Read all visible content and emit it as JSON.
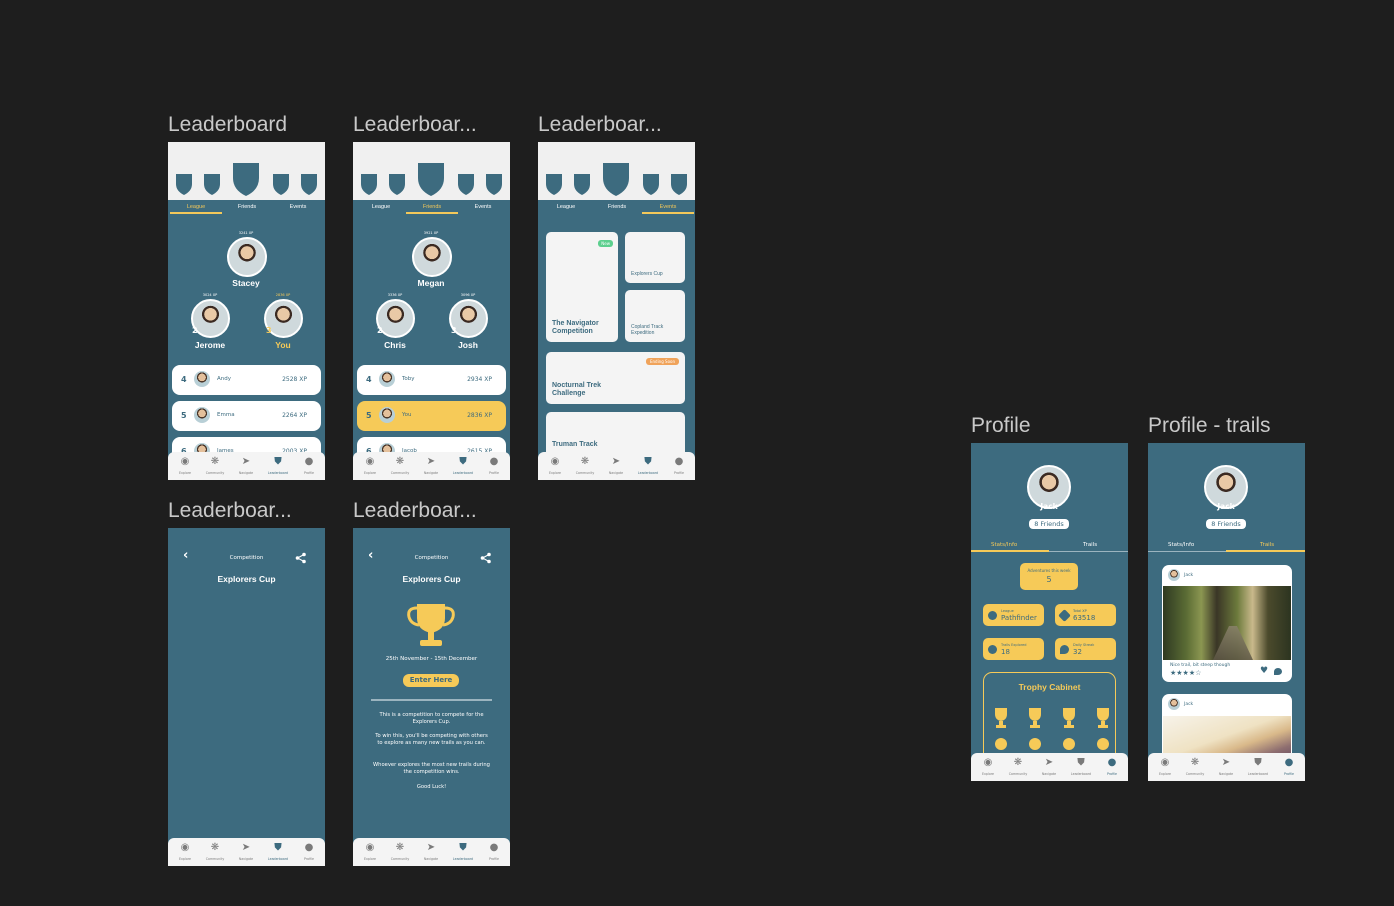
{
  "frames": {
    "lb1": "Leaderboard",
    "lb2": "Leaderboar...",
    "lb3": "Leaderboar...",
    "lb4": "Leaderboar...",
    "lb5": "Leaderboar...",
    "profile": "Profile",
    "profile_trails": "Profile - trails"
  },
  "tabs": {
    "league": "League",
    "friends": "Friends",
    "events": "Events"
  },
  "nav": {
    "explore": "Explore",
    "community": "Community",
    "navigate": "Navigate",
    "leaderboard": "Leaderboard",
    "profile": "Profile"
  },
  "league": {
    "first": {
      "name": "Stacey",
      "xp": "3241 XP"
    },
    "second": {
      "name": "Jerome",
      "xp": "3024 XP",
      "rank": "2"
    },
    "third": {
      "name": "You",
      "xp": "2836 XP",
      "rank": "3"
    },
    "rows": [
      {
        "rank": "4",
        "name": "Andy",
        "xp": "2528 XP"
      },
      {
        "rank": "5",
        "name": "Emma",
        "xp": "2264 XP"
      },
      {
        "rank": "6",
        "name": "James",
        "xp": "2003 XP"
      }
    ]
  },
  "friends": {
    "first": {
      "name": "Megan",
      "xp": "3921 XP"
    },
    "second": {
      "name": "Chris",
      "xp": "3336 XP",
      "rank": "2"
    },
    "third": {
      "name": "Josh",
      "xp": "3096 XP",
      "rank": "3"
    },
    "rows": [
      {
        "rank": "4",
        "name": "Toby",
        "xp": "2934 XP"
      },
      {
        "rank": "5",
        "name": "You",
        "xp": "2836 XP"
      },
      {
        "rank": "6",
        "name": "Jacob",
        "xp": "2615 XP"
      }
    ]
  },
  "events": {
    "navigator": "The Navigator Competition",
    "new_badge": "New",
    "explorers": "Explorers Cup",
    "copland": "Copland Track Expedition",
    "nocturnal": "Nocturnal Trek Challenge",
    "ending_soon": "Ending Soon",
    "truman": "Truman Track"
  },
  "competition": {
    "header": "Competition",
    "title": "Explorers Cup",
    "dates": "25th November - 15th December",
    "enter": "Enter Here",
    "p1": "This is a competition to compete for the Explorers Cup.",
    "p2": "To win this, you'll be competing with others to explore as many new trails as you can.",
    "p3": "Whoever explores the most new trails during the competition wins.",
    "p4": "Good Luck!"
  },
  "profile": {
    "name": "Jack",
    "friends": "8 Friends",
    "tab_stats": "Stats/Info",
    "tab_trails": "Trails",
    "adventures_label": "Adventures this week",
    "adventures_value": "5",
    "league_label": "League",
    "league_value": "Pathfinder",
    "xp_label": "Total XP",
    "xp_value": "63518",
    "trails_label": "Trails Explored",
    "trails_value": "18",
    "streak_label": "Daily Streak",
    "streak_value": "32",
    "trophy_title": "Trophy Cabinet",
    "post_user": "Jack",
    "post_caption": "Nice trail, bit steep though",
    "post_stars": "★★★★☆",
    "post2_user": "Jack"
  },
  "colors": {
    "teal": "#3d6b7f",
    "yellow": "#f6ca58",
    "light": "#f4f4f4",
    "green": "#5ccf8e",
    "orange": "#f0a35a"
  }
}
